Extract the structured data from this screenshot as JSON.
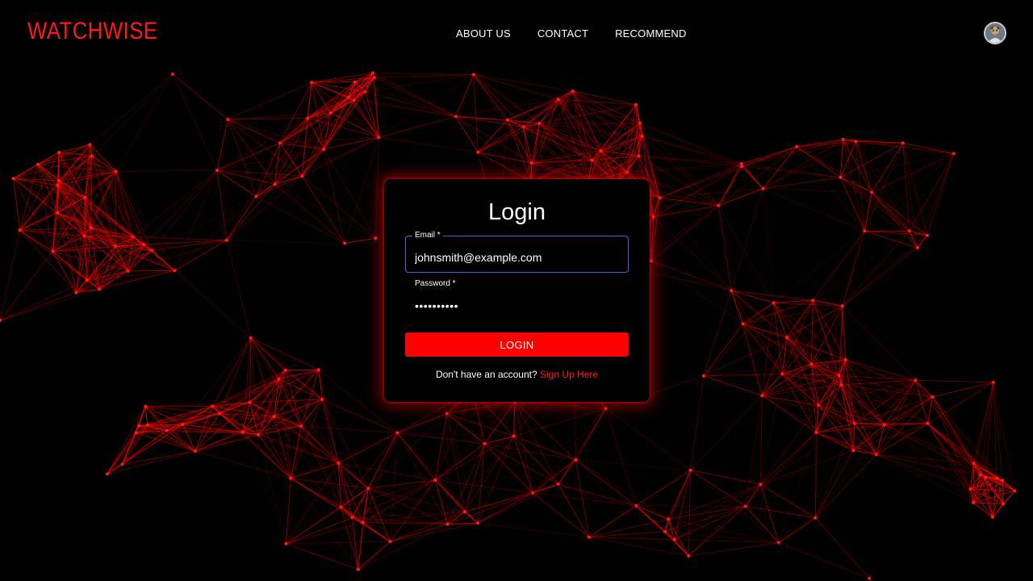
{
  "header": {
    "logo": "WATCHWISE",
    "nav": [
      "ABOUT US",
      "CONTACT",
      "RECOMMEND"
    ]
  },
  "login": {
    "title": "Login",
    "email_label": "Email *",
    "email_value": "johnsmith@example.com",
    "password_label": "Password *",
    "password_value": "••••••••••",
    "button": "LOGIN",
    "signup_prompt": "Don't have an account?",
    "signup_link": "Sign Up Here"
  },
  "colors": {
    "accent": "#ff0000",
    "background": "#000000",
    "focus_border": "#3d6fd6"
  },
  "icons": {
    "avatar": "user-avatar-icon"
  }
}
